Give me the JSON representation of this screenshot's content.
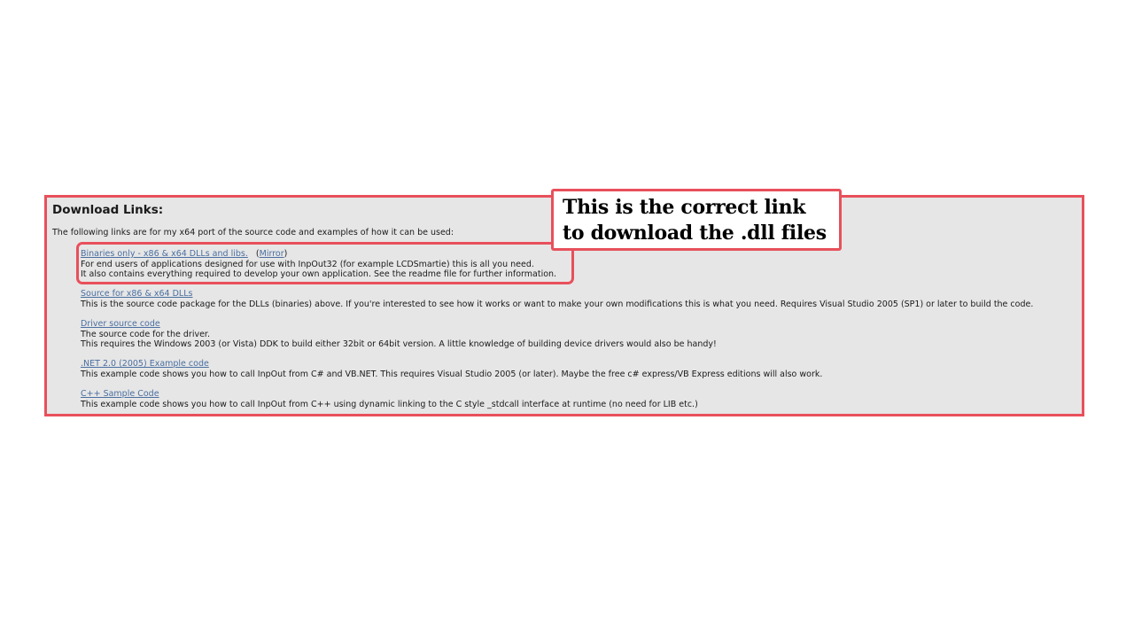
{
  "section": {
    "heading": "Download Links:",
    "intro": "The following links are for my x64 port of the source code and examples of how it can be used:"
  },
  "entries": [
    {
      "link": "Binaries only - x86 & x64 DLLs and libs.",
      "mirror_open": "(",
      "mirror": "Mirror",
      "mirror_close": ")",
      "lines": [
        "For end users of applications designed for use with InpOut32 (for example LCDSmartie) this is all you need.",
        "It also contains everything required to develop your own application. See the readme file for further information."
      ]
    },
    {
      "link": "Source for x86 & x64 DLLs",
      "lines": [
        "This is the source code package for the DLLs (binaries) above. If you're interested to see how it works or want to make your own modifications this is what you need. Requires Visual Studio 2005 (SP1) or later to build the code."
      ]
    },
    {
      "link": "Driver source code",
      "lines": [
        "The source code for the driver.",
        "This requires the Windows 2003 (or Vista) DDK to build either 32bit or 64bit version. A little knowledge of building device drivers would also be handy!"
      ]
    },
    {
      "link": ".NET 2.0 (2005) Example code",
      "lines": [
        "This example code shows you how to call InpOut from C# and VB.NET. This requires Visual Studio 2005 (or later). Maybe the free c# express/VB Express editions will also work."
      ]
    },
    {
      "link": "C++ Sample Code",
      "lines": [
        "This example code shows you how to call InpOut from C++ using dynamic linking to the C style _stdcall interface at runtime (no need for LIB etc.)"
      ]
    }
  ],
  "callout": {
    "line1": "This is the correct link",
    "line2": "to download the .dll files"
  },
  "colors": {
    "annotation_border": "#e8505b",
    "panel_background": "#e6e6e6",
    "link": "#4a6fa0"
  }
}
